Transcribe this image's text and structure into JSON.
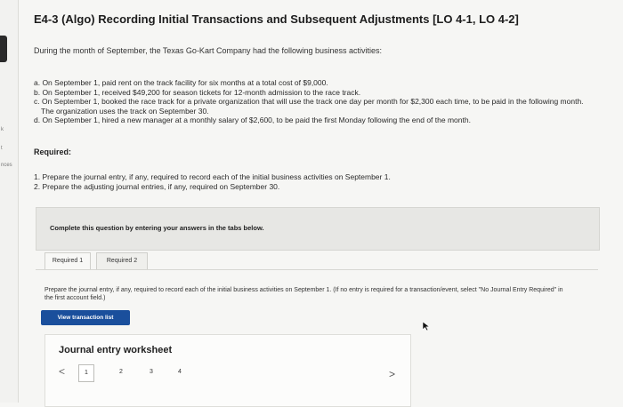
{
  "sidebar": {
    "fragment_top": "k",
    "fragment_mid": "t",
    "fragment_low": "nces"
  },
  "problem": {
    "title": "E4-3 (Algo) Recording Initial Transactions and Subsequent Adjustments [LO 4-1, LO 4-2]",
    "intro": "During the month of September, the Texas Go-Kart Company had the following business activities:",
    "activities": [
      "a. On September 1, paid rent on the track facility for six months at a total cost of $9,000.",
      "b. On September 1, received $49,200 for season tickets for 12-month admission to the race track.",
      "c. On September 1, booked the race track for a private organization that will use the track one day per month for $2,300 each time, to be paid in the following month. The organization uses the track on September 30.",
      "d. On September 1, hired a new manager at a monthly salary of $2,600, to be paid the first Monday following the end of the month."
    ],
    "required_heading": "Required:",
    "required": [
      "1. Prepare the journal entry, if any, required to record each of the initial business activities on September 1.",
      "2. Prepare the adjusting journal entries, if any, required on September 30."
    ]
  },
  "panel": {
    "text": "Complete this question by entering your answers in the tabs below."
  },
  "tabs": [
    {
      "label": "Required 1"
    },
    {
      "label": "Required 2"
    }
  ],
  "instruction": {
    "text": "Prepare the journal entry, if any, required to record each of the initial business activities on September 1. ",
    "note": "(If no entry is required for a transaction/event, select \"No Journal Entry Required\" in the first account field.)"
  },
  "buttons": {
    "view_transaction_list": "View transaction list"
  },
  "worksheet": {
    "title": "Journal entry worksheet",
    "pages": [
      "1",
      "2",
      "3",
      "4"
    ],
    "prev": "<",
    "next": ">"
  }
}
